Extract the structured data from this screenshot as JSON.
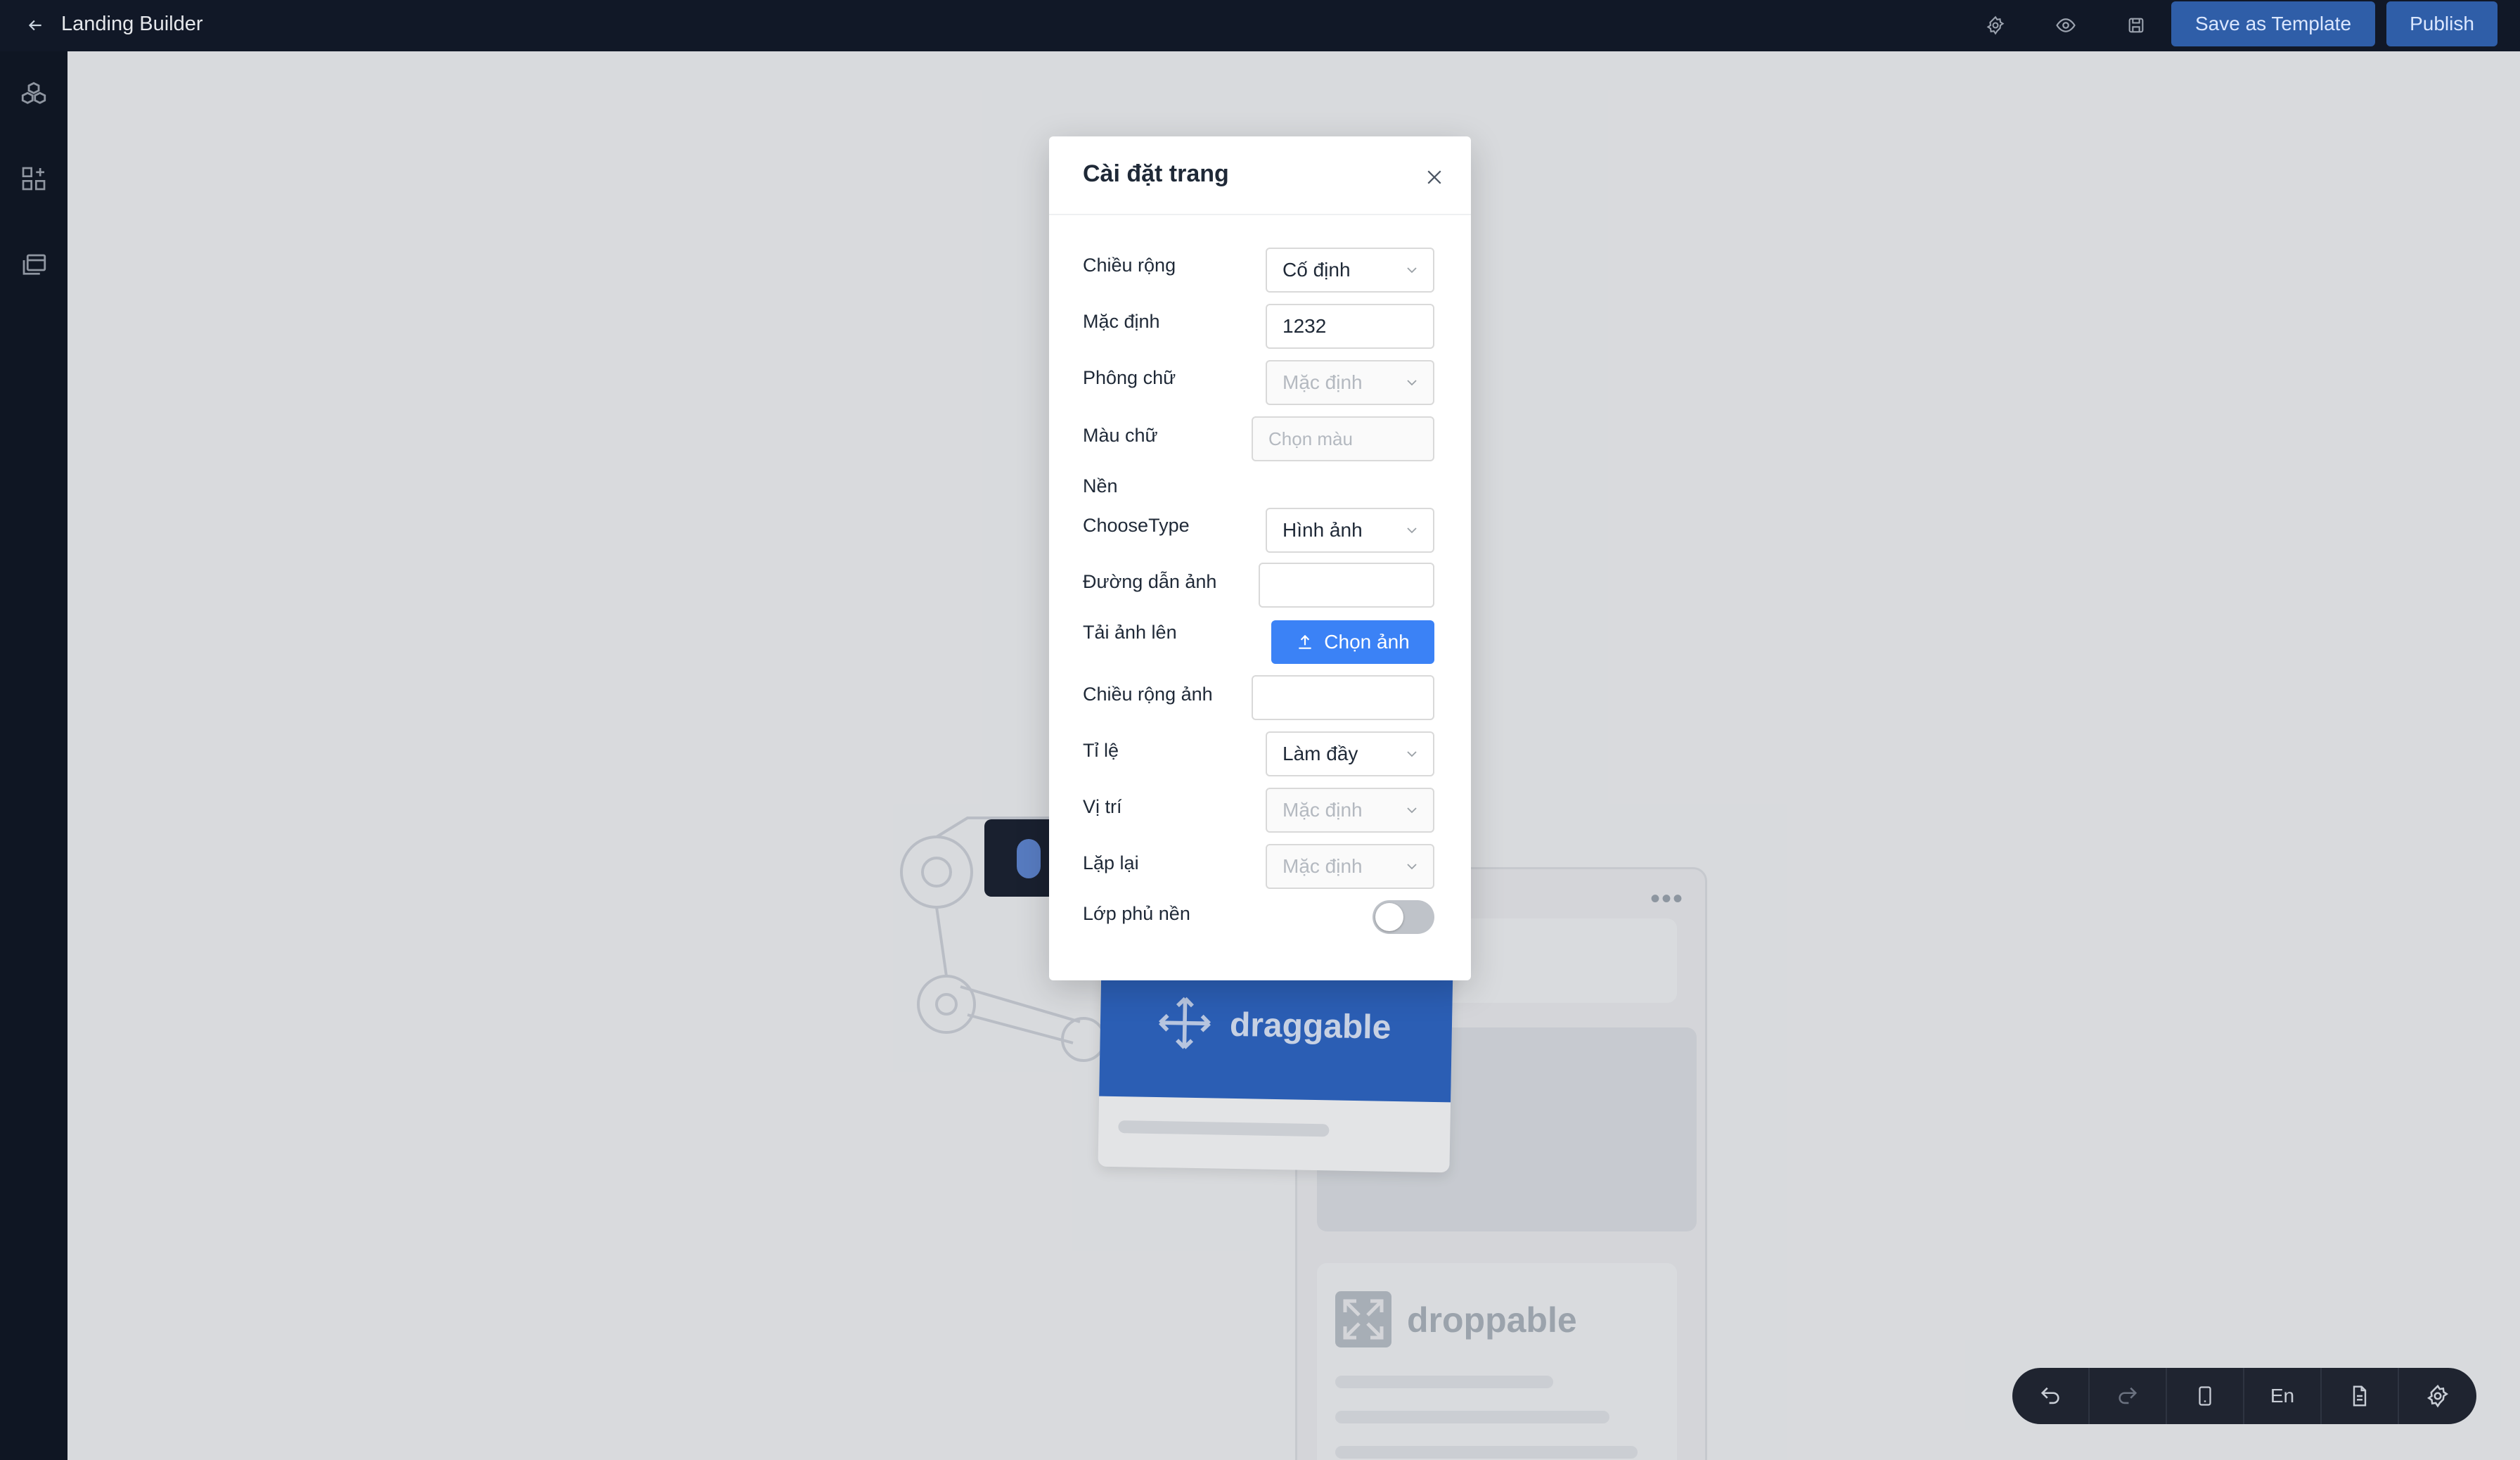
{
  "app": {
    "title": "Landing Builder"
  },
  "toolbar": {
    "save_template_label": "Save as Template",
    "publish_label": "Publish",
    "icons": [
      "settings-icon",
      "eye-icon",
      "save-icon"
    ]
  },
  "sidebar": {
    "icons": [
      "blocks-icon",
      "add-widget-icon",
      "pages-icon"
    ]
  },
  "illustration": {
    "draggable_label": "draggable",
    "droppable_label": "droppable"
  },
  "modal": {
    "title": "Cài đặt trang",
    "fields": {
      "width_label": "Chiều rộng",
      "width_value": "Cố định",
      "default_label": "Mặc định",
      "default_value": "1232",
      "font_label": "Phông chữ",
      "font_placeholder": "Mặc định",
      "text_color_label": "Màu chữ",
      "text_color_placeholder": "Chọn màu",
      "background_label": "Nền",
      "choose_type_label": "ChooseType",
      "choose_type_value": "Hình ảnh",
      "image_path_label": "Đường dẫn ảnh",
      "image_path_value": "",
      "upload_label": "Tải ảnh lên",
      "upload_button": "Chọn ảnh",
      "image_width_label": "Chiều rộng ảnh",
      "image_width_value": "",
      "ratio_label": "Tỉ lệ",
      "ratio_value": "Làm đầy",
      "position_label": "Vị trí",
      "position_placeholder": "Mặc định",
      "repeat_label": "Lặp lại",
      "repeat_placeholder": "Mặc định",
      "overlay_label": "Lớp phủ nền",
      "overlay_enabled": false
    }
  },
  "bottom_toolbar": {
    "items": [
      "undo-icon",
      "redo-icon",
      "mobile-icon",
      "En",
      "document-icon",
      "settings-icon"
    ],
    "language_label": "En"
  },
  "colors": {
    "topbar_bg": "#111827",
    "primary_button": "#2f5ea8",
    "upload_button": "#3b82f6",
    "draggable_blue": "#2f66c4"
  }
}
